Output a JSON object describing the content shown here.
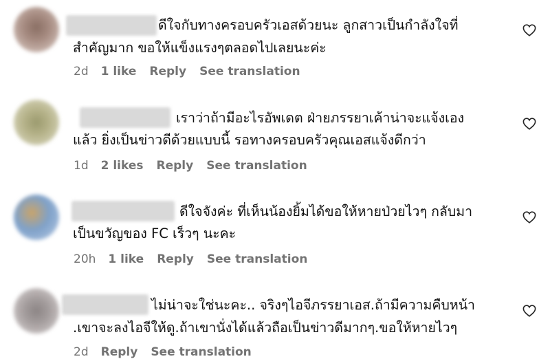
{
  "comments": [
    {
      "line1": "ดีใจกับทางครอบครัวเอสด้วยนะ ลูกสาวเป็นกำลังใจที่",
      "line2": "สำคัญมาก ขอให้แข็งแรงๆตลอดไปเลยนะค่ะ",
      "time": "2d",
      "likes": "1 like",
      "reply": "Reply",
      "translate": "See translation",
      "heart_icon": "heart-icon"
    },
    {
      "line1": "เราว่าถ้ามีอะไรอัพเดต ฝ่ายภรรยาเค้าน่าจะแจ้งเอง",
      "line2": "แล้ว ยิ่งเป็นข่าวดีด้วยแบบนี้ รอทางครอบครัวคุณเอสแจ้งดีกว่า",
      "time": "1d",
      "likes": "2 likes",
      "reply": "Reply",
      "translate": "See translation",
      "heart_icon": "heart-icon"
    },
    {
      "line1": "ดีใจจังค่ะ ที่เห็นน้องยิ้มได้ขอให้หายป่วยไวๆ กลับมา",
      "line2": "เป็นขวัญของ FC เร็วๆ นะคะ",
      "time": "20h",
      "likes": "1 like",
      "reply": "Reply",
      "translate": "See translation",
      "heart_icon": "heart-icon"
    },
    {
      "line1": "ไม่น่าจะใช่นะคะ.. จริงๆไอจีภรรยาเอส.ถ้ามีความคืบหน้า",
      "line2": ".เขาจะลงไอจีให้ดู.ถ้าเขานั่งได้แล้วถือเป็นข่าวดีมากๆ.ขอให้หายไวๆ",
      "time": "2d",
      "likes": "",
      "reply": "Reply",
      "translate": "See translation",
      "heart_icon": "heart-icon"
    }
  ]
}
